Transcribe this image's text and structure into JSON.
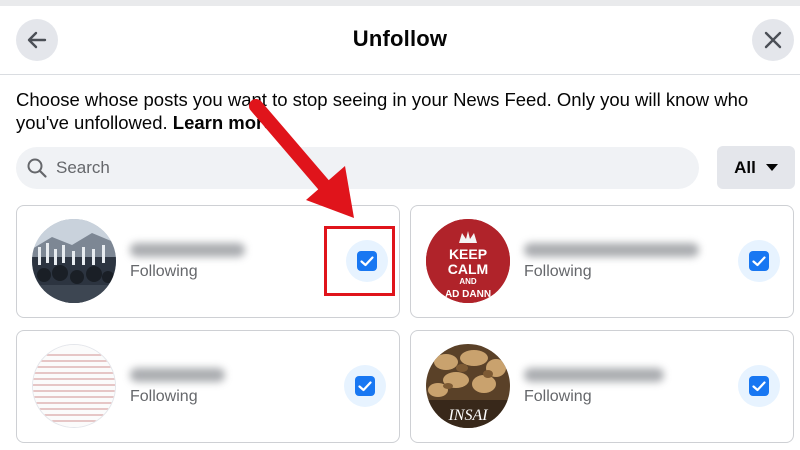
{
  "header": {
    "title": "Unfollow",
    "back_icon": "arrow-left-icon",
    "close_icon": "close-icon"
  },
  "description": {
    "text": "Choose whose posts you want to stop seeing in your News Feed. Only you will know who you've unfollowed.",
    "link": "Learn more"
  },
  "search": {
    "placeholder": "Search",
    "icon": "search-icon"
  },
  "filter": {
    "label": "All",
    "icon": "caret-down-icon"
  },
  "cards": [
    {
      "status": "Following",
      "checked": true,
      "highlighted": true
    },
    {
      "status": "Following",
      "checked": true,
      "avatar_text": [
        "KEEP",
        "CALM",
        "AND",
        "AD DANN"
      ]
    },
    {
      "status": "Following",
      "checked": true
    },
    {
      "status": "Following",
      "checked": true,
      "avatar_text": [
        "INSAI"
      ]
    }
  ],
  "colors": {
    "accent": "#1877f2",
    "annotation": "#e0141b",
    "check_bg": "#e7f3ff"
  }
}
